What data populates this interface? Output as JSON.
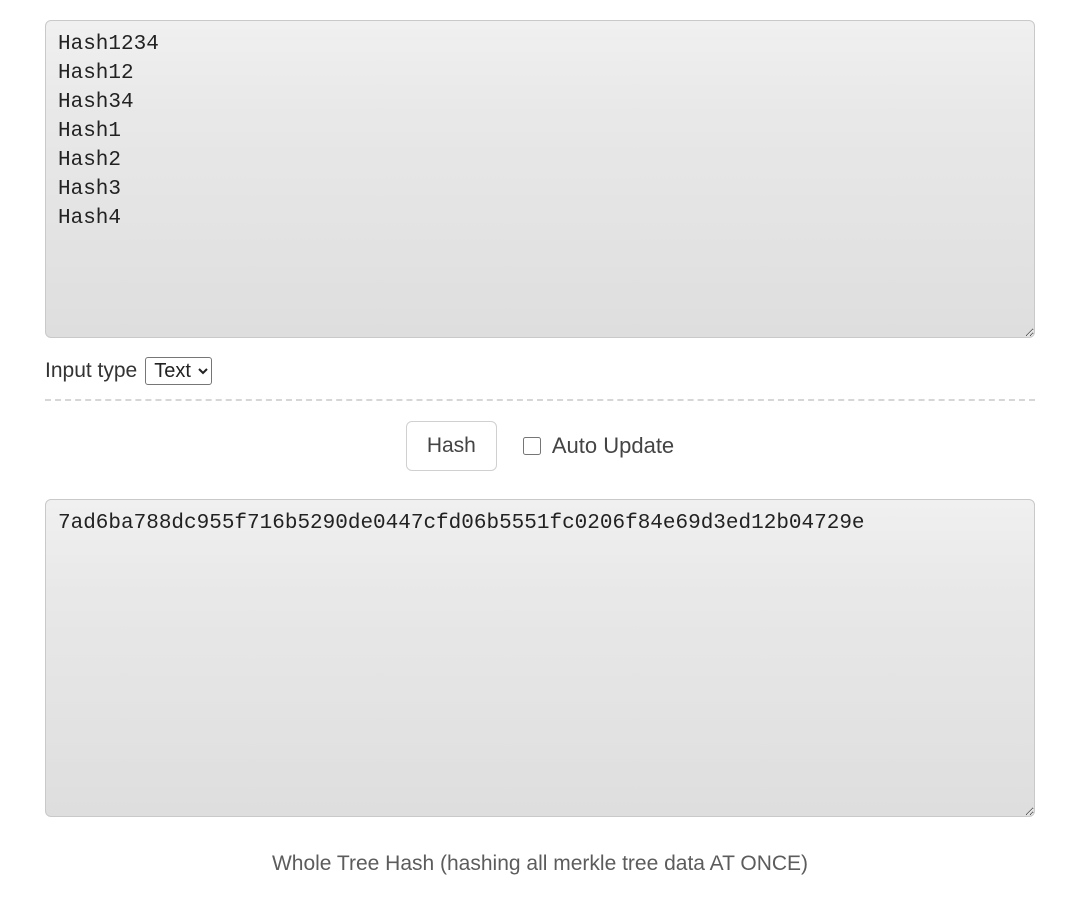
{
  "input": {
    "value": "Hash1234\nHash12\nHash34\nHash1\nHash2\nHash3\nHash4"
  },
  "input_type": {
    "label": "Input type",
    "selected": "Text",
    "options": [
      "Text"
    ]
  },
  "actions": {
    "hash_label": "Hash",
    "auto_update_label": "Auto Update",
    "auto_update_checked": false
  },
  "output": {
    "value": "7ad6ba788dc955f716b5290de0447cfd06b5551fc0206f84e69d3ed12b04729e"
  },
  "caption": "Whole Tree Hash (hashing all merkle tree data AT ONCE)"
}
